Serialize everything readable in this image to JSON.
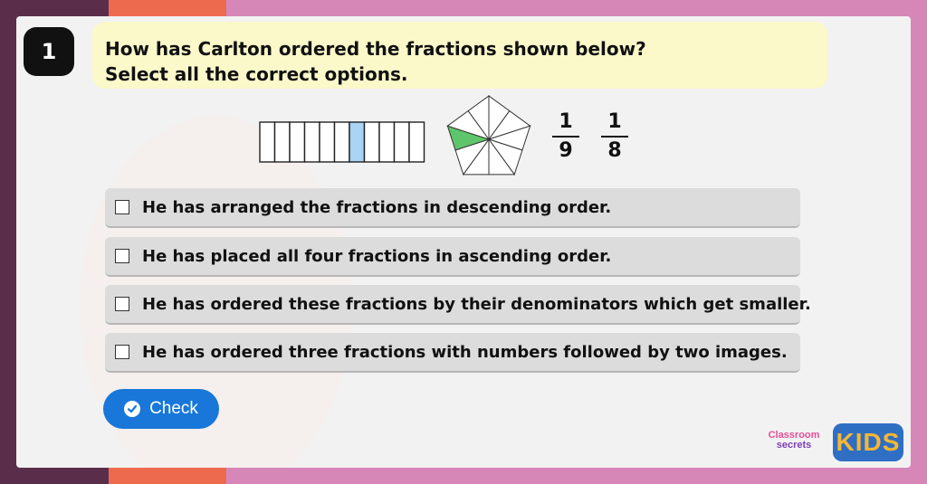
{
  "question": {
    "number": "1",
    "line1": "How has Carlton ordered the fractions shown below?",
    "line2": "Select all the correct options."
  },
  "visuals": {
    "strip": {
      "segments": 11,
      "shaded_index": 6,
      "shade_color": "#a9d4f5"
    },
    "pentagon": {
      "segments": 10,
      "shaded": 1,
      "shade_color": "#5fc56a"
    },
    "fractions": [
      {
        "numerator": "1",
        "denominator": "9"
      },
      {
        "numerator": "1",
        "denominator": "8"
      }
    ]
  },
  "options": [
    {
      "label": "He has arranged the fractions in descending order.",
      "checked": false
    },
    {
      "label": "He has placed all four fractions in ascending order.",
      "checked": false
    },
    {
      "label": "He has ordered these fractions by their denominators which get smaller.",
      "checked": false
    },
    {
      "label": "He has ordered three fractions with numbers followed by two images.",
      "checked": false
    }
  ],
  "check_button": {
    "label": "Check",
    "icon": "check-circle-icon",
    "color": "#1877d9"
  },
  "branding": {
    "classroom_line1": "Classroom",
    "classroom_line2": "secrets",
    "kids": "KIDS"
  },
  "colors": {
    "question_bg": "#fbf8c9",
    "option_bg": "#dcdcdc",
    "page_bg": "#d687b8"
  }
}
